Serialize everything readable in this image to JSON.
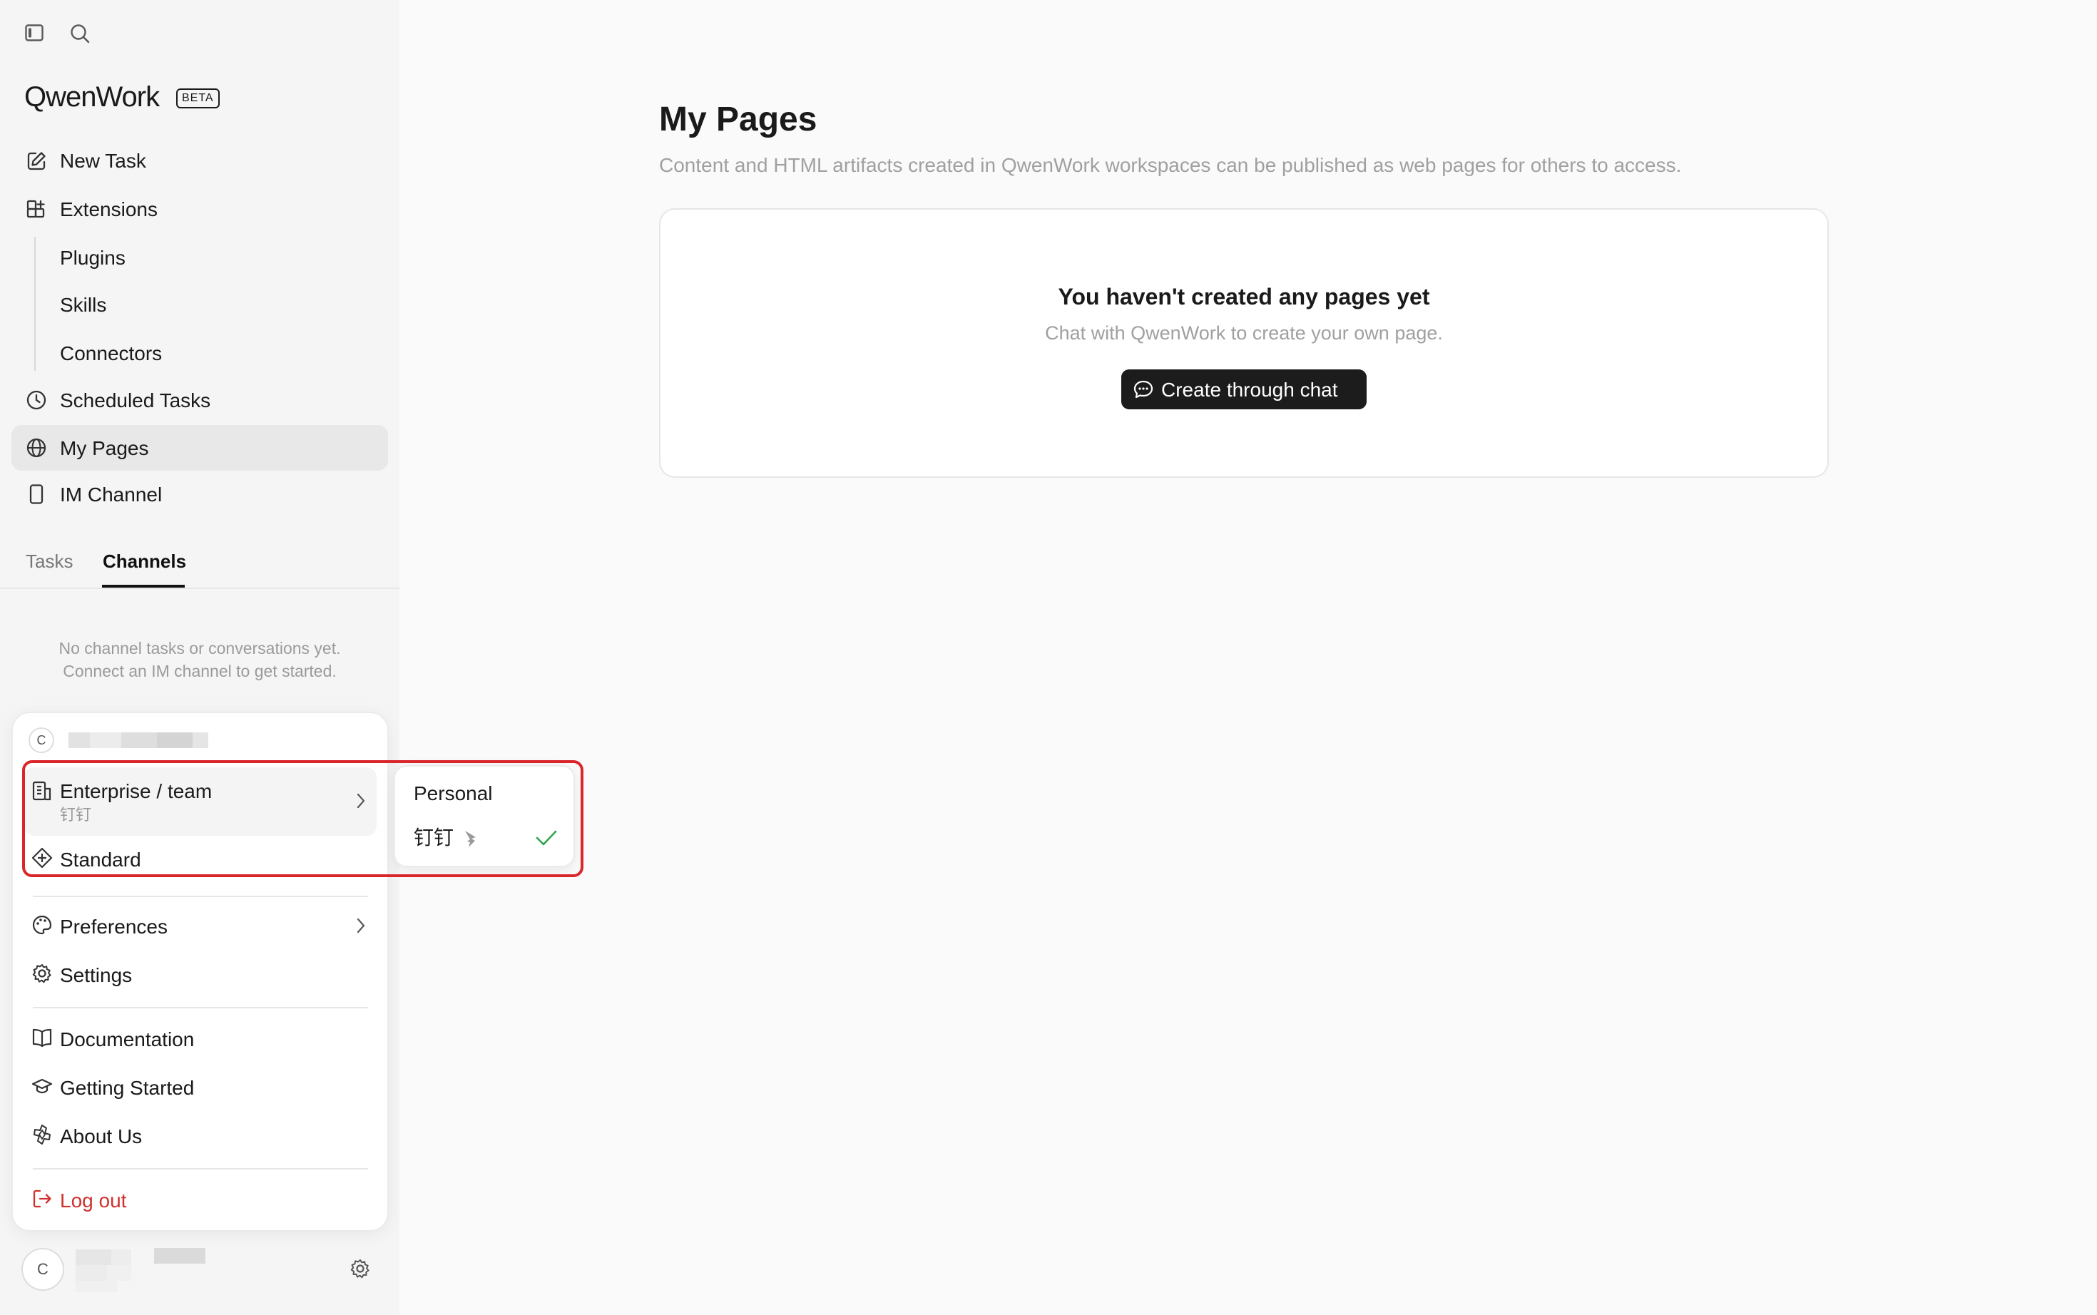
{
  "sidebar": {
    "brand": "QwenWork",
    "brand_badge": "BETA",
    "nav": {
      "new_task": "New Task",
      "extensions": "Extensions",
      "plugins": "Plugins",
      "skills": "Skills",
      "connectors": "Connectors",
      "scheduled_tasks": "Scheduled Tasks",
      "my_pages": "My Pages",
      "im_channel": "IM Channel"
    },
    "tabs": [
      "Tasks",
      "Channels"
    ],
    "active_tab": "Channels",
    "empty_line1": "No channel tasks or conversations yet.",
    "empty_line2": "Connect an IM channel to get started.",
    "user_initial": "C"
  },
  "account_menu": {
    "user_initial": "C",
    "org_label": "Enterprise / team",
    "org_sub": "钉钉",
    "plan": "Standard",
    "preferences": "Preferences",
    "settings": "Settings",
    "documentation": "Documentation",
    "getting_started": "Getting Started",
    "about_us": "About Us",
    "logout": "Log out"
  },
  "org_submenu": {
    "personal": "Personal",
    "dingtalk": "钉钉"
  },
  "main": {
    "title": "My Pages",
    "subtitle": "Content and HTML artifacts created in QwenWork workspaces can be published as web pages for others to access.",
    "empty_title": "You haven't created any pages yet",
    "empty_desc": "Chat with QwenWork to create your own page.",
    "create_button": "Create through chat"
  },
  "colors": {
    "sidebar_bg": "#f5f5f5",
    "active_item_bg": "#e8e8e8",
    "primary_button": "#1c1c1c",
    "logout_red": "#d0312d",
    "highlight_red": "#d8262b",
    "check_green": "#2ea44f"
  },
  "icons": {
    "sidebar_toggle": "sidebar-toggle-icon",
    "search": "search-icon",
    "new_task": "edit-icon",
    "extensions": "grid-plus-icon",
    "scheduled": "clock-icon",
    "pages": "globe-icon",
    "im_channel": "phone-icon",
    "enterprise": "building-icon",
    "standard": "diamond-icon",
    "preferences": "palette-icon",
    "settings": "gear-icon",
    "documentation": "book-icon",
    "getting_started": "graduation-cap-icon",
    "about": "qwen-logo-icon",
    "logout": "logout-icon",
    "chat": "chat-bubble-icon",
    "check": "check-icon"
  }
}
